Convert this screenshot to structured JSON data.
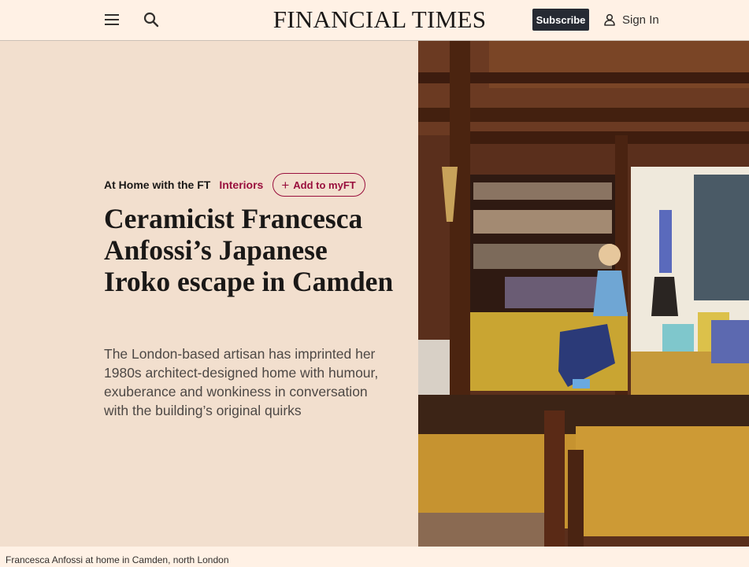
{
  "header": {
    "masthead": "FINANCIAL TIMES",
    "subscribe_label": "Subscribe",
    "signin_label": "Sign In",
    "icons": {
      "menu": "menu-icon",
      "search": "search-icon",
      "user": "user-icon"
    }
  },
  "article": {
    "series": "At Home with the FT",
    "topic": "Interiors",
    "myft_label": "Add to myFT",
    "headline": "Ceramicist Francesca Anfossi’s Japanese Iroko escape in Camden",
    "standfirst": "The London-based artisan has imprinted her 1980s architect-designed home with humour, exuberance and wonkiness in conversation with the building’s original quirks"
  },
  "image": {
    "caption": "Francesca Anfossi at home in Camden, north London"
  },
  "colors": {
    "page_background": "#fff1e5",
    "panel_background": "#f2dfce",
    "claret": "#990f3d",
    "subscribe_background": "#262a33",
    "headline": "#1a1817"
  }
}
